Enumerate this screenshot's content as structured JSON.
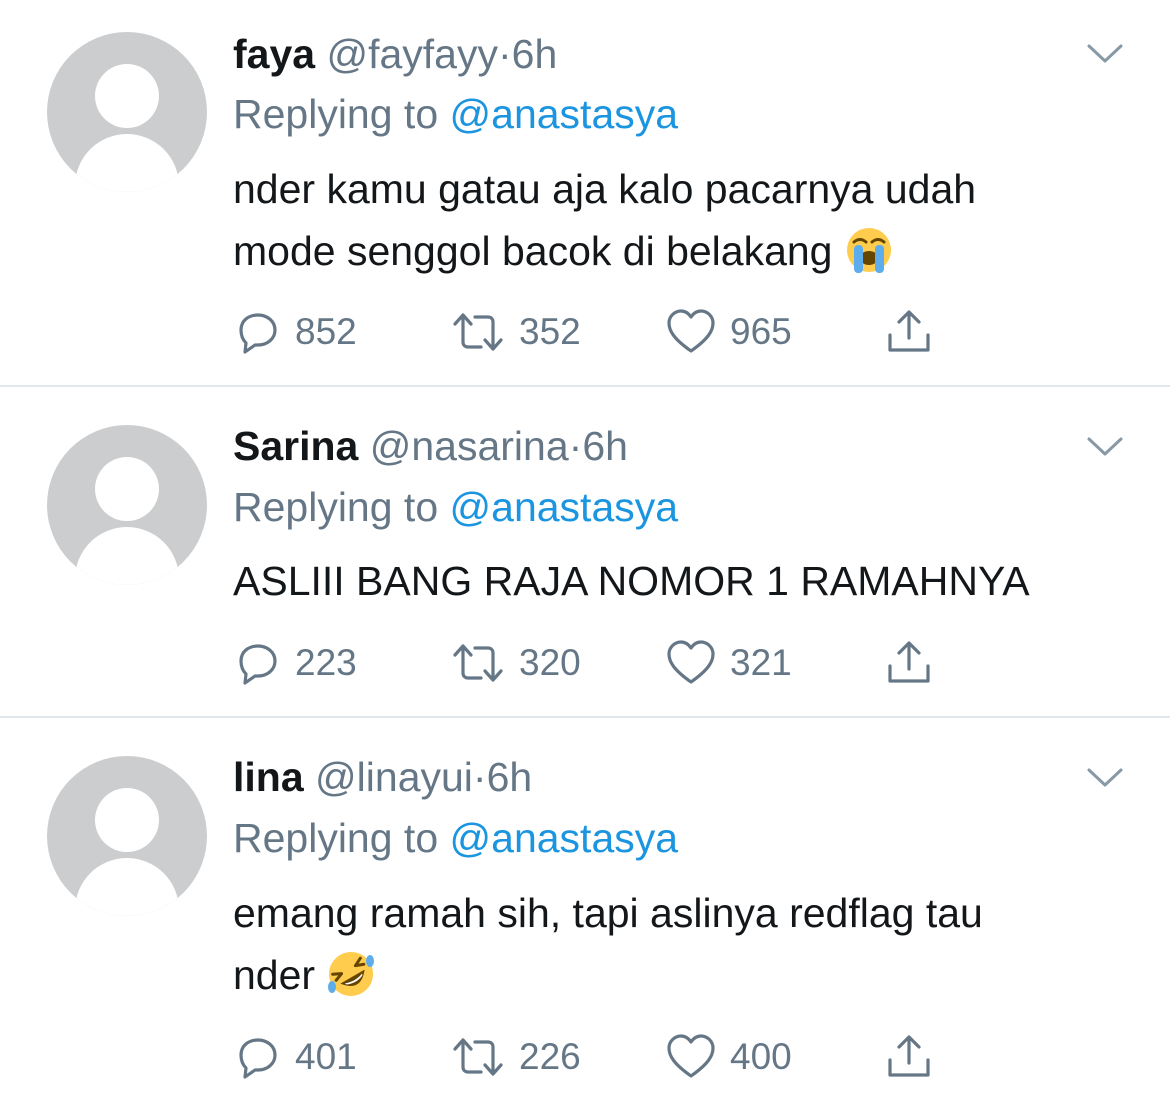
{
  "tweets": [
    {
      "name": "faya",
      "handle": "@fayfayy",
      "separator": "·",
      "time": "6h",
      "replying_label": "Replying to",
      "replying_to": "@anastasya",
      "text_line1": "nder kamu gatau aja kalo pacarnya udah",
      "text_line2": "mode senggol bacok di belakang",
      "emoji": "loudly-crying-face",
      "replies": "852",
      "retweets": "352",
      "likes": "965"
    },
    {
      "name": "Sarina",
      "handle": "@nasarina",
      "separator": "·",
      "time": "6h",
      "replying_label": "Replying to",
      "replying_to": "@anastasya",
      "text_line1": "ASLIII BANG RAJA NOMOR 1 RAMAHNYA",
      "replies": "223",
      "retweets": "320",
      "likes": "321"
    },
    {
      "name": "lina",
      "handle": "@linayui",
      "separator": "·",
      "time": "6h",
      "replying_label": "Replying to",
      "replying_to": "@anastasya",
      "text_line1": "emang ramah sih, tapi aslinya redflag tau",
      "text_line2": "nder",
      "emoji": "rolling-on-the-floor-laughing",
      "replies": "401",
      "retweets": "226",
      "likes": "400"
    }
  ],
  "colors": {
    "text": "#14171a",
    "secondary": "#657786",
    "link": "#1b95e0",
    "divider": "#e1e8ed",
    "avatar": "#cccdce"
  },
  "icons": [
    "reply-icon",
    "retweet-icon",
    "like-icon",
    "share-icon",
    "chevron-down-icon"
  ]
}
